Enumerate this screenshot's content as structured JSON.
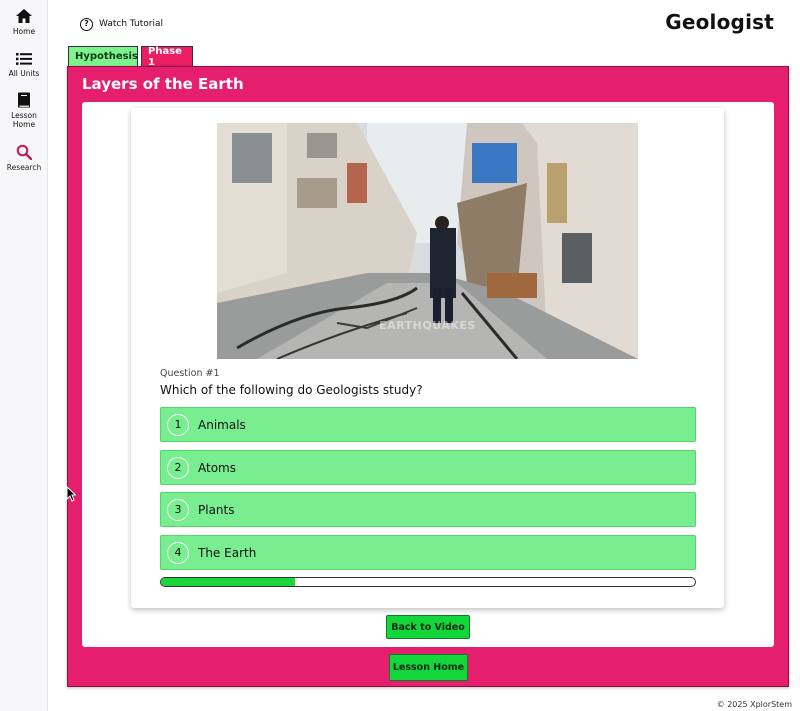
{
  "sidebar": {
    "items": [
      {
        "label": "Home",
        "icon": "home-icon"
      },
      {
        "label": "All Units",
        "icon": "list-icon"
      },
      {
        "label": "Lesson Home",
        "icon": "book-icon"
      },
      {
        "label": "Research",
        "icon": "search-icon"
      }
    ]
  },
  "header": {
    "tutorial_label": "Watch Tutorial",
    "brand": "Geologist"
  },
  "tabs": [
    {
      "label": "Hypothesis",
      "color": "#7df28e"
    },
    {
      "label": "Phase 1",
      "color": "#e91e63"
    }
  ],
  "main": {
    "title": "Layers of the Earth",
    "image_watermark": "EARTHQUAKES",
    "question_number": "Question #1",
    "question_text": "Which of the following do Geologists study?",
    "answers": [
      {
        "num": "1",
        "label": "Animals"
      },
      {
        "num": "2",
        "label": "Atoms"
      },
      {
        "num": "3",
        "label": "Plants"
      },
      {
        "num": "4",
        "label": "The Earth"
      }
    ],
    "progress_fraction": 0.25,
    "back_button": "Back to Video",
    "lesson_home_button": "Lesson Home"
  },
  "footer": {
    "copyright": "© 2025 XplorStem"
  },
  "colors": {
    "accent_pink": "#e51e6e",
    "answer_green": "#78ee90",
    "button_green": "#12d63a"
  }
}
